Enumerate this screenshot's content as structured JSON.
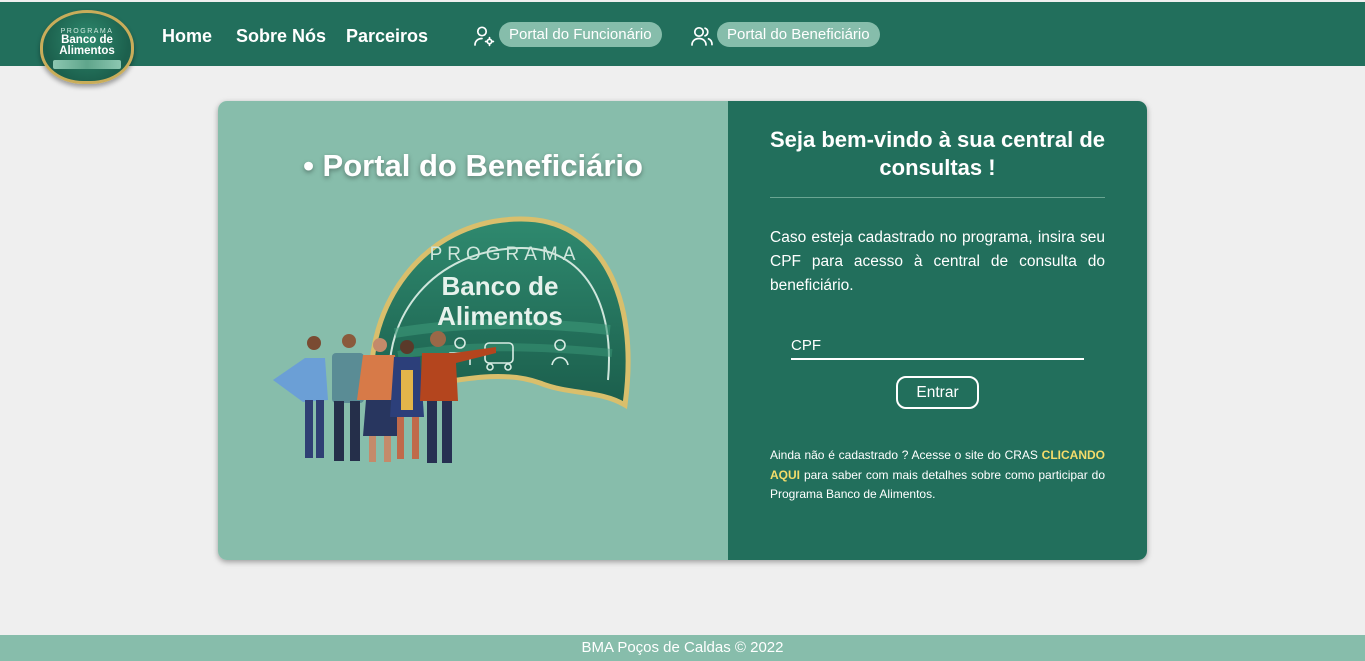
{
  "header": {
    "logo": {
      "line_top": "PROGRAMA",
      "line_main_1": "Banco de",
      "line_main_2": "Alimentos"
    },
    "nav": {
      "home": "Home",
      "about": "Sobre Nós",
      "partners": "Parceiros"
    },
    "employee_portal": {
      "label": "Portal do Funcionário",
      "icon": "user-gear-icon"
    },
    "beneficiary_portal": {
      "label": "Portal do Beneficiário",
      "icon": "users-icon"
    }
  },
  "card": {
    "left_title": "• Portal do Beneficiário",
    "emblem": {
      "line_top": "PROGRAMA",
      "line_main_1": "Banco de",
      "line_main_2": "Alimentos"
    },
    "welcome": "Seja bem-vindo à sua central de consultas !",
    "instruction": "Caso esteja cadastrado no programa, insira seu CPF para acesso à central de consulta do beneficiário.",
    "cpf_placeholder": "CPF",
    "enter_label": "Entrar",
    "info_before": "Ainda não é cadastrado ? Acesse o site do CRAS ",
    "info_link": "CLICANDO AQUI",
    "info_after": " para saber com mais detalhes sobre como participar do Programa Banco de Alimentos."
  },
  "footer": {
    "text": "BMA Poços de Caldas © 2022"
  },
  "colors": {
    "primary_green": "#226f5c",
    "light_green": "#87bdab",
    "link_yellow": "#f4dc6a",
    "background": "#efefef"
  }
}
